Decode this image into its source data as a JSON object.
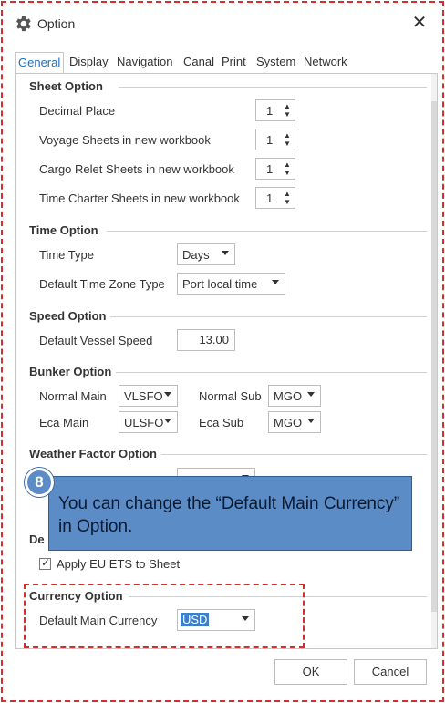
{
  "window": {
    "title": "Option",
    "close_icon": "close-icon",
    "settings_icon": "gear-icon"
  },
  "tabs": [
    {
      "label": "General",
      "active": true
    },
    {
      "label": "Display"
    },
    {
      "label": "Navigation"
    },
    {
      "label": "Canal"
    },
    {
      "label": "Print"
    },
    {
      "label": "System"
    },
    {
      "label": "Network"
    }
  ],
  "sheet_option": {
    "title": "Sheet Option",
    "rows": [
      {
        "label": "Decimal Place",
        "value": "1"
      },
      {
        "label": "Voyage Sheets in new workbook",
        "value": "1"
      },
      {
        "label": "Cargo Relet Sheets in new workbook",
        "value": "1"
      },
      {
        "label": "Time Charter Sheets in new workbook",
        "value": "1"
      }
    ]
  },
  "time_option": {
    "title": "Time Option",
    "time_type_label": "Time Type",
    "time_type_value": "Days",
    "tz_label": "Default Time Zone Type",
    "tz_value": "Port local time"
  },
  "speed_option": {
    "title": "Speed Option",
    "label": "Default Vessel Speed",
    "value": "13.00"
  },
  "bunker_option": {
    "title": "Bunker Option",
    "normal_main_label": "Normal Main",
    "normal_main_value": "VLSFO",
    "normal_sub_label": "Normal Sub",
    "normal_sub_value": "MGO",
    "eca_main_label": "Eca Main",
    "eca_main_value": "ULSFO",
    "eca_sub_label": "Eca Sub",
    "eca_sub_value": "MGO"
  },
  "weather_option": {
    "title": "Weather Factor Option"
  },
  "eu_option": {
    "title_partial": "De",
    "checkbox_label": "Apply EU ETS to Sheet",
    "checked": true
  },
  "currency_option": {
    "title": "Currency Option",
    "label": "Default Main Currency",
    "value": "USD"
  },
  "callout": {
    "step": "8",
    "text": "You can change the “Default Main Currency” in Option."
  },
  "footer": {
    "ok_label": "OK",
    "cancel_label": "Cancel"
  },
  "colors": {
    "highlight_dash": "#d32f2f",
    "callout_fill": "#5b8cc6",
    "active_tab": "#1e6fbf",
    "selection": "#3d7fc9"
  }
}
